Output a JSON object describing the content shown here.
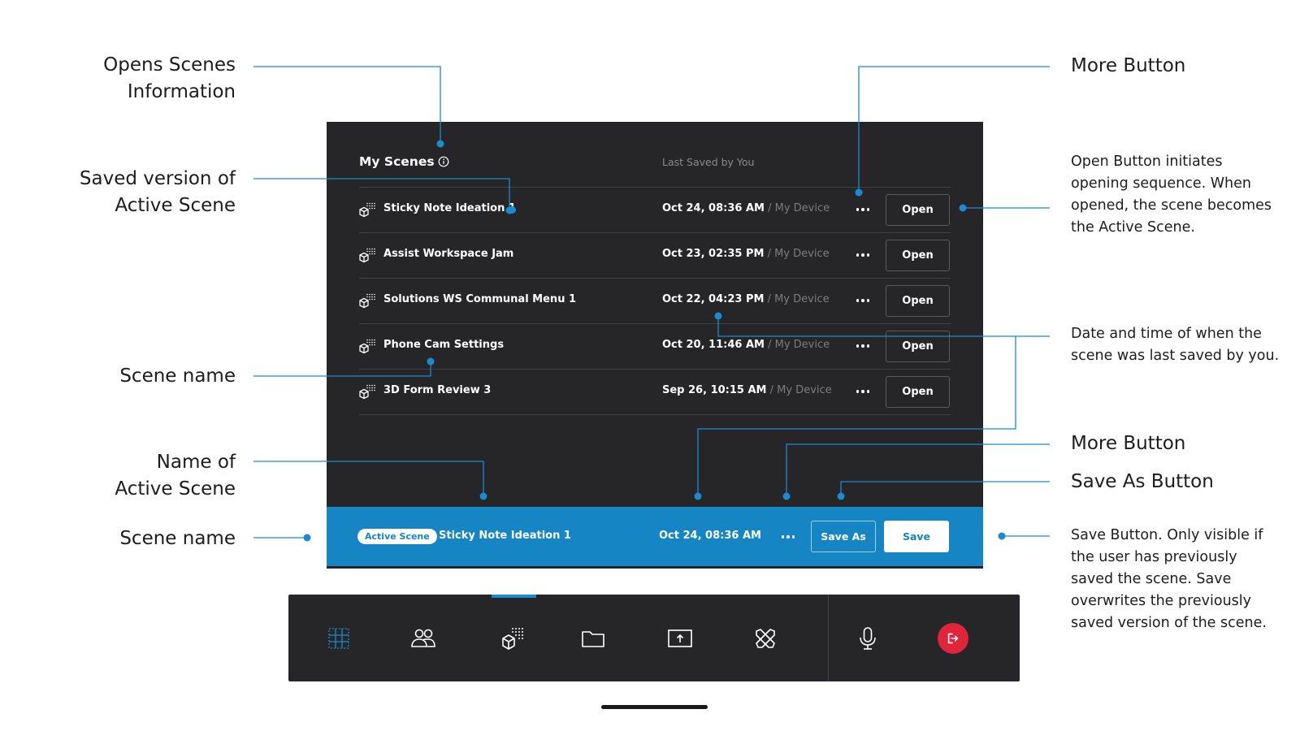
{
  "annotations": {
    "left": {
      "opens_info": [
        "Opens Scenes",
        "Information"
      ],
      "saved_version": [
        "Saved version of",
        "Active Scene"
      ],
      "scene_name_row": [
        "Scene name"
      ],
      "name_of_active": [
        "Name of",
        "Active Scene"
      ],
      "scene_name_active": [
        "Scene name"
      ]
    },
    "right": {
      "more_button_top": "More Button",
      "open_button_desc": "Open Button initiates opening sequence. When opened, the scene becomes the Active Scene.",
      "date_time_desc": "Date and time of when the scene was last saved by you.",
      "more_button_bottom": "More Button",
      "save_as_button": "Save As Button",
      "save_button_desc": "Save Button. Only visible if the user has previously saved the scene. Save overwrites the previously saved version of the scene."
    }
  },
  "panel": {
    "title": "My Scenes",
    "column_header": "Last Saved by You",
    "rows": [
      {
        "name": "Sticky Note Ideation 1",
        "date": "Oct 24, 08:36 AM",
        "separator": " / ",
        "device": "My Device",
        "open_label": "Open",
        "unsaved_indicator": true
      },
      {
        "name": "Assist Workspace Jam",
        "date": "Oct 23, 02:35 PM",
        "separator": " / ",
        "device": "My Device",
        "open_label": "Open"
      },
      {
        "name": "Solutions WS Communal Menu 1",
        "date": "Oct 22, 04:23 PM",
        "separator": " / ",
        "device": "My Device",
        "open_label": "Open"
      },
      {
        "name": "Phone Cam Settings",
        "date": "Oct 20, 11:46 AM",
        "separator": " / ",
        "device": "My Device",
        "open_label": "Open"
      },
      {
        "name": "3D Form Review 3",
        "date": "Sep 26, 10:15 AM",
        "separator": " / ",
        "device": "My Device",
        "open_label": "Open"
      }
    ]
  },
  "active_bar": {
    "pill_label": "Active Scene",
    "scene_name": "Sticky Note Ideation 1",
    "date": "Oct 24, 08:36 AM",
    "save_as_label": "Save As",
    "save_label": "Save"
  },
  "toolbar": {
    "tools": [
      "grid-icon",
      "people-icon",
      "scenes-icon",
      "folder-icon",
      "share-screen-icon",
      "tools-icon",
      "microphone-icon",
      "exit-icon"
    ],
    "active_tool": "scenes-icon"
  },
  "colors": {
    "accent": "#1585c4",
    "panel_bg": "#262628",
    "exit_red": "#e0243a",
    "leader_line": "#1a8bd0"
  }
}
